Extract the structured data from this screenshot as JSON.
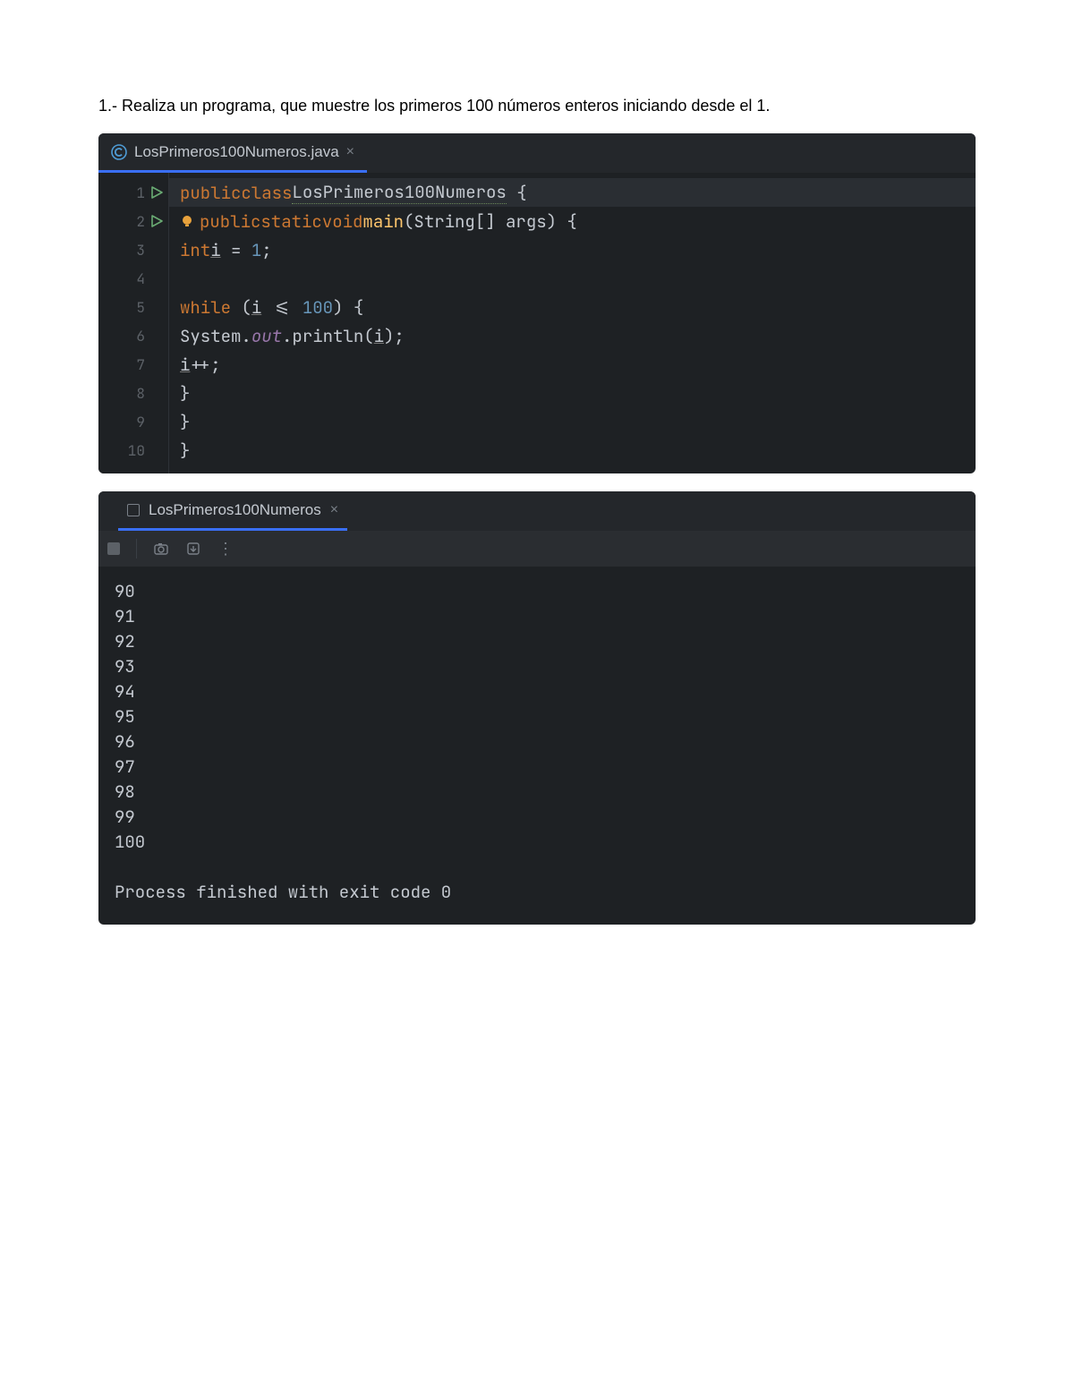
{
  "instruction": "1.- Realiza un programa, que muestre los primeros 100 números enteros iniciando desde el 1.",
  "editor": {
    "tab_filename": "LosPrimeros100Numeros.java",
    "close_glyph": "×",
    "lines": [
      {
        "num": "1",
        "run": true,
        "hl": true
      },
      {
        "num": "2",
        "run": true,
        "hl": false
      },
      {
        "num": "3",
        "run": false,
        "hl": false
      },
      {
        "num": "4",
        "run": false,
        "hl": false
      },
      {
        "num": "5",
        "run": false,
        "hl": false
      },
      {
        "num": "6",
        "run": false,
        "hl": false
      },
      {
        "num": "7",
        "run": false,
        "hl": false
      },
      {
        "num": "8",
        "run": false,
        "hl": false
      },
      {
        "num": "9",
        "run": false,
        "hl": false
      },
      {
        "num": "10",
        "run": false,
        "hl": false
      }
    ],
    "code": {
      "l1": {
        "kw1": "public",
        "kw2": "class",
        "cls": "LosPrimeros100Numeros",
        "brace": " {"
      },
      "l2": {
        "kw1": "public",
        "kw2": "static",
        "kw3": "void",
        "mname": "main",
        "params": "(String[] args) {"
      },
      "l3": {
        "type": "int",
        "var": "i",
        "rest": " = ",
        "num": "1",
        "semi": ";"
      },
      "l5": {
        "kw": "while",
        "open": " (",
        "var": "i",
        "cmp": " <= ",
        "num": "100",
        "close": ") {"
      },
      "l6": {
        "sys": "System.",
        "out": "out",
        "call": ".println(",
        "var": "i",
        "end": ");"
      },
      "l7": {
        "var": "i",
        "inc": "++;"
      },
      "l8": {
        "brace": "}"
      },
      "l9": {
        "brace": "}"
      },
      "l10": {
        "brace": "}"
      }
    }
  },
  "console": {
    "tab_name": "LosPrimeros100Numeros",
    "close_glyph": "×",
    "toolbar_more": "⋮",
    "output_lines": [
      "90",
      "91",
      "92",
      "93",
      "94",
      "95",
      "96",
      "97",
      "98",
      "99",
      "100"
    ],
    "exit_line": "Process finished with exit code 0"
  }
}
